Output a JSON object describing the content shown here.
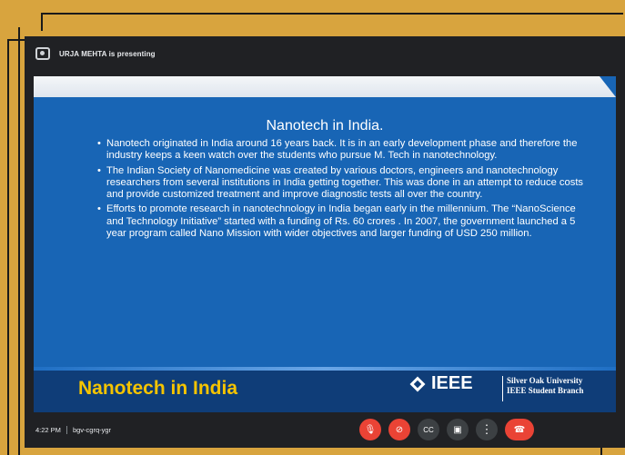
{
  "presenter": {
    "label": "URJA MEHTA is presenting",
    "icon": "presentation-icon"
  },
  "slide": {
    "title": "Nanotech in India.",
    "bullets": [
      "Nanotech originated in India around 16 years back. It is in an early development phase and therefore the industry keeps a keen watch over the students who pursue M. Tech in nanotechnology.",
      "The Indian Society of Nanomedicine was created by various doctors, engineers and nanotechnology researchers from several institutions in India getting together. This was done in an attempt to reduce costs and provide customized treatment and improve diagnostic tests all over the country.",
      "Efforts to promote research in nanotechnology in India began early in the millennium. The “NanoScience and Technology Initiative” started with a funding of Rs. 60 crores . In 2007, the government launched a 5 year program called Nano Mission with wider objectives and larger funding of USD 250 million."
    ],
    "footer_title": "Nanotech in India",
    "logo_text": "IEEE",
    "org_line1": "Silver Oak University",
    "org_line2": "IEEE Student Branch"
  },
  "meeting": {
    "time": "4:22 PM",
    "code": "bgv-cgrq-ygr",
    "controls": [
      {
        "name": "mic-off-button",
        "icon": "mic-off-icon",
        "glyph": "🎙",
        "style": "red"
      },
      {
        "name": "camera-off-button",
        "icon": "camera-off-icon",
        "glyph": "⊘",
        "style": "red"
      },
      {
        "name": "captions-button",
        "icon": "captions-icon",
        "glyph": "CC",
        "style": "grey"
      },
      {
        "name": "present-button",
        "icon": "present-icon",
        "glyph": "▣",
        "style": "grey"
      },
      {
        "name": "more-options-button",
        "icon": "more-vert-icon",
        "glyph": "⋮",
        "style": "grey"
      },
      {
        "name": "leave-call-button",
        "icon": "hang-up-icon",
        "glyph": "☎",
        "style": "end"
      }
    ]
  },
  "colors": {
    "background": "#d8a43e",
    "slide_blue": "#1865b5",
    "footer_title": "#f5c400",
    "meet_bg": "#202124",
    "end_call": "#ea4335"
  }
}
